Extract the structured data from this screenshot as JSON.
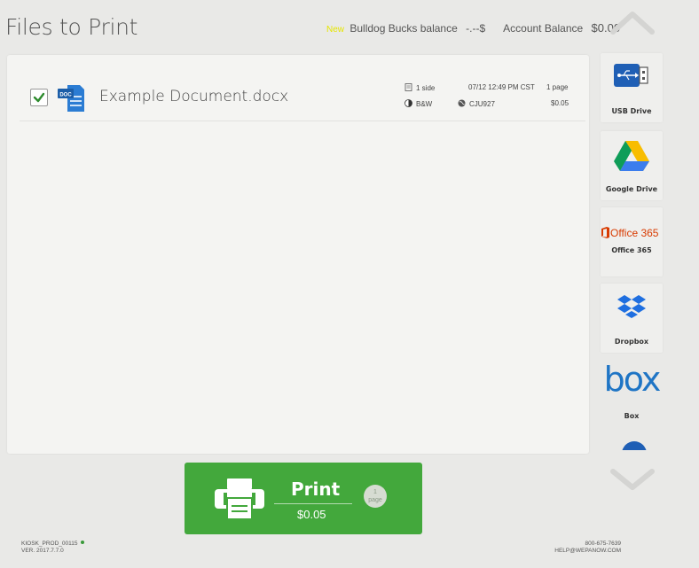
{
  "header": {
    "title": "Files to Print",
    "new_tag": "New",
    "bulldog_label": "Bulldog Bucks balance",
    "bulldog_value": "-.--$",
    "account_label": "Account Balance",
    "account_value": "$0.00"
  },
  "file": {
    "name": "Example Document.docx",
    "icon_tag": "DOC",
    "checked": true,
    "sides": "1 side",
    "color_mode": "B&W",
    "datetime": "07/12 12:49 PM CST",
    "release_code": "CJU927",
    "pages": "1 page",
    "cost": "$0.05"
  },
  "sources": [
    {
      "label": "USB Drive",
      "icon": "usb-icon"
    },
    {
      "label": "Google Drive",
      "icon": "google-drive-icon"
    },
    {
      "label": "Office 365",
      "icon": "office365-icon",
      "logo_text": "Office 365"
    },
    {
      "label": "Dropbox",
      "icon": "dropbox-icon"
    },
    {
      "label": "Box",
      "icon": "box-icon",
      "logo_text": "box"
    }
  ],
  "print": {
    "label": "Print",
    "price": "$0.05",
    "page_count": "1",
    "page_word": "page"
  },
  "footer": {
    "kiosk_id": "KIOSK_PROD_00115",
    "version": "VER. 2017.7.7.0",
    "phone": "800-675-7639",
    "email": "HELP@WEPANOW.COM"
  },
  "colors": {
    "accent_green": "#43a83c",
    "office_red": "#d83b01",
    "box_blue": "#1f75c5"
  }
}
